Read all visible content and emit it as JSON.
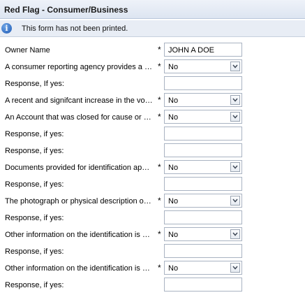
{
  "title": "Red Flag - Consumer/Business",
  "info_message": "This form has not been printed.",
  "info_icon": "info-icon",
  "required_mark": "*",
  "rows": [
    {
      "label": "Owner Name",
      "required": true,
      "type": "text",
      "value": "JOHN A DOE"
    },
    {
      "label": "A consumer reporting agency provides a n...",
      "required": true,
      "type": "select",
      "value": "No"
    },
    {
      "label": "Response, If yes:",
      "required": false,
      "type": "text",
      "value": ""
    },
    {
      "label": "A recent and signifcant increase in the vol...",
      "required": true,
      "type": "select",
      "value": "No"
    },
    {
      "label": "An Account that was closed for cause or id...",
      "required": true,
      "type": "select",
      "value": "No"
    },
    {
      "label": "Response, if yes:",
      "required": false,
      "type": "text",
      "value": ""
    },
    {
      "label": "Response, if yes:",
      "required": false,
      "type": "text",
      "value": ""
    },
    {
      "label": "Documents provided for identification appe...",
      "required": true,
      "type": "select",
      "value": "No"
    },
    {
      "label": "Response, if yes:",
      "required": false,
      "type": "text",
      "value": ""
    },
    {
      "label": "The photograph or physical description on ...",
      "required": true,
      "type": "select",
      "value": "No"
    },
    {
      "label": "Response, if yes:",
      "required": false,
      "type": "text",
      "value": ""
    },
    {
      "label": "Other information on the identification is not...",
      "required": true,
      "type": "select",
      "value": "No"
    },
    {
      "label": "Response, if yes:",
      "required": false,
      "type": "text",
      "value": ""
    },
    {
      "label": "Other information on the identification is not...",
      "required": true,
      "type": "select",
      "value": "No"
    },
    {
      "label": "Response, if yes:",
      "required": false,
      "type": "text",
      "value": ""
    }
  ]
}
